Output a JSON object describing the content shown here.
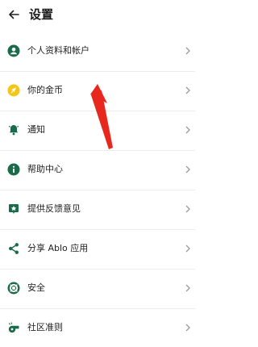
{
  "header": {
    "title": "设置"
  },
  "items": [
    {
      "label": "个人资料和帐户",
      "icon": "account-circle-icon"
    },
    {
      "label": "你的金币",
      "icon": "coin-icon"
    },
    {
      "label": "通知",
      "icon": "bell-icon"
    },
    {
      "label": "帮助中心",
      "icon": "info-icon"
    },
    {
      "label": "提供反馈意见",
      "icon": "feedback-star-icon"
    },
    {
      "label": "分享 Ablo 应用",
      "icon": "share-icon"
    },
    {
      "label": "安全",
      "icon": "lifebuoy-icon"
    },
    {
      "label": "社区准则",
      "icon": "whistle-icon"
    }
  ],
  "colors": {
    "icon_green": "#1a6b4a",
    "coin_yellow": "#f5c518",
    "annotation_red": "#e8281e",
    "chevron": "#9a9a9a"
  }
}
